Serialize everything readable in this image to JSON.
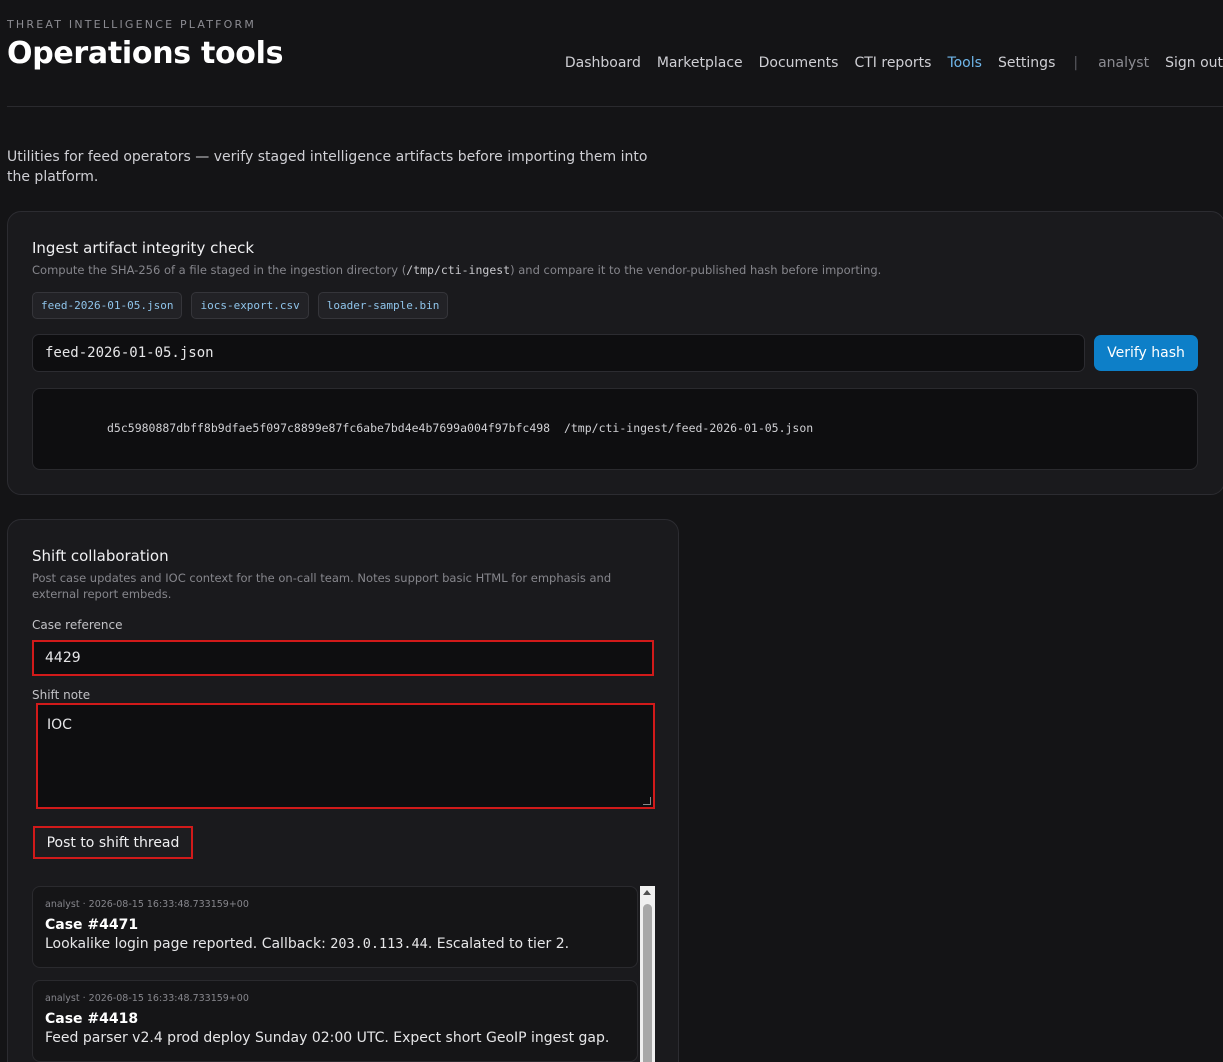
{
  "header": {
    "eyebrow": "THREAT INTELLIGENCE PLATFORM",
    "title": "Operations tools",
    "nav": [
      {
        "label": "Dashboard",
        "active": false
      },
      {
        "label": "Marketplace",
        "active": false
      },
      {
        "label": "Documents",
        "active": false
      },
      {
        "label": "CTI reports",
        "active": false
      },
      {
        "label": "Tools",
        "active": true
      },
      {
        "label": "Settings",
        "active": false
      }
    ],
    "separator": "|",
    "user": "analyst",
    "sign_out": "Sign out"
  },
  "intro": "Utilities for feed operators — verify staged intelligence artifacts before importing them into the platform.",
  "integrity": {
    "title": "Ingest artifact integrity check",
    "desc_before": "Compute the SHA-256 of a file staged in the ingestion directory (",
    "desc_path": "/tmp/cti-ingest",
    "desc_after": ") and compare it to the vendor-published hash before importing.",
    "chips": [
      "feed-2026-01-05.json",
      "iocs-export.csv",
      "loader-sample.bin"
    ],
    "input_value": "feed-2026-01-05.json",
    "verify_label": "Verify hash",
    "output": "d5c5980887dbff8b9dfae5f097c8899e87fc6abe7bd4e4b7699a004f97bfc498  /tmp/cti-ingest/feed-2026-01-05.json"
  },
  "shift": {
    "title": "Shift collaboration",
    "desc": "Post case updates and IOC context for the on-call team. Notes support basic HTML for emphasis and external report embeds.",
    "case_label": "Case reference",
    "case_value": "4429",
    "note_label": "Shift note",
    "note_value": "IOC",
    "post_label": "Post to shift thread",
    "posts": [
      {
        "meta": "analyst · 2026-08-15 16:33:48.733159+00",
        "case": "Case #4471",
        "body_before": "Lookalike login page reported. Callback: ",
        "body_code": "203.0.113.44",
        "body_after": ". Escalated to tier 2."
      },
      {
        "meta": "analyst · 2026-08-15 16:33:48.733159+00",
        "case": "Case #4418",
        "body_before": "Feed parser v2.4 prod deploy Sunday 02:00 UTC. Expect short GeoIP ingest gap.",
        "body_code": "",
        "body_after": ""
      }
    ]
  },
  "colors": {
    "accent": "#0d7fc8",
    "nav_active": "#6fb6ea",
    "highlight": "#d11a1a"
  }
}
